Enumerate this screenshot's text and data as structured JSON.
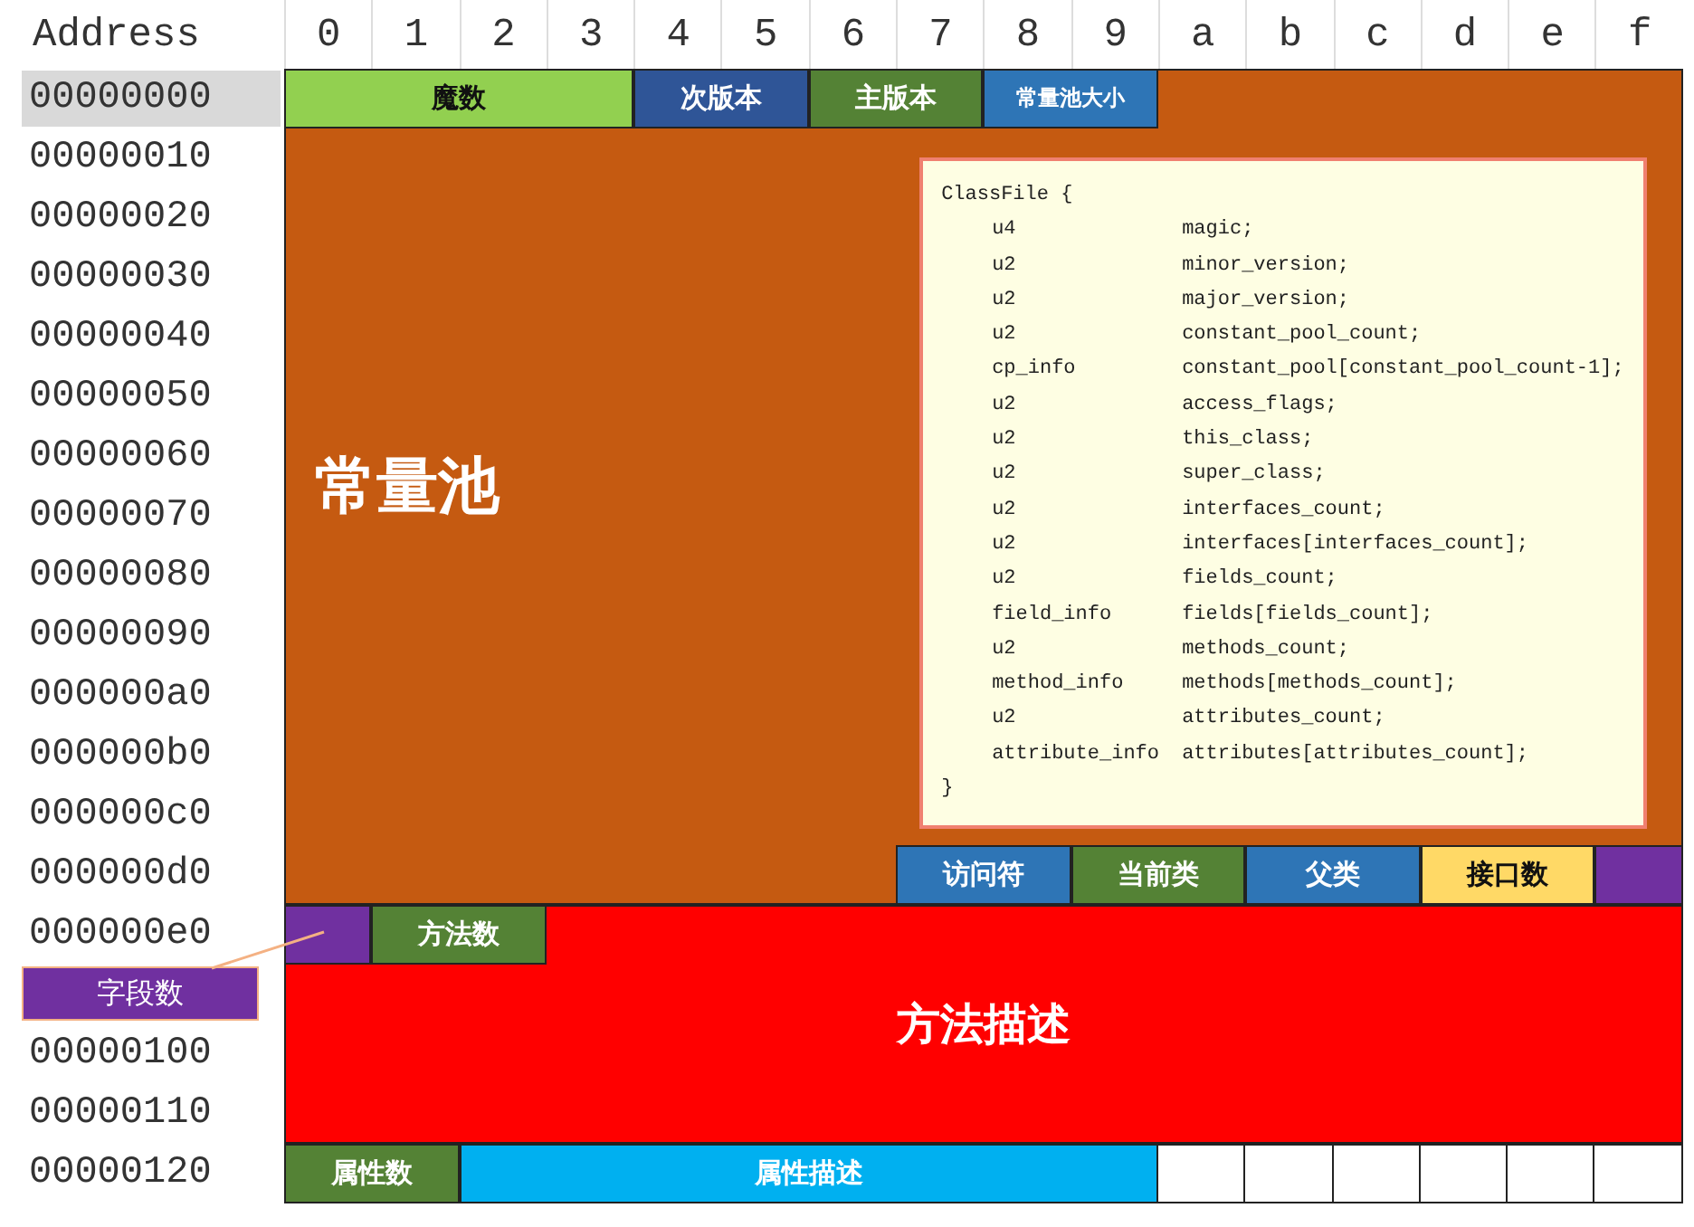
{
  "header": {
    "label": "Address",
    "columns": [
      "0",
      "1",
      "2",
      "3",
      "4",
      "5",
      "6",
      "7",
      "8",
      "9",
      "a",
      "b",
      "c",
      "d",
      "e",
      "f"
    ]
  },
  "rows": [
    {
      "kind": "address",
      "text": "00000000",
      "selected": true
    },
    {
      "kind": "address",
      "text": "00000010",
      "selected": false
    },
    {
      "kind": "address",
      "text": "00000020",
      "selected": false
    },
    {
      "kind": "address",
      "text": "00000030",
      "selected": false
    },
    {
      "kind": "address",
      "text": "00000040",
      "selected": false
    },
    {
      "kind": "address",
      "text": "00000050",
      "selected": false
    },
    {
      "kind": "address",
      "text": "00000060",
      "selected": false
    },
    {
      "kind": "address",
      "text": "00000070",
      "selected": false
    },
    {
      "kind": "address",
      "text": "00000080",
      "selected": false
    },
    {
      "kind": "address",
      "text": "00000090",
      "selected": false
    },
    {
      "kind": "address",
      "text": "000000a0",
      "selected": false
    },
    {
      "kind": "address",
      "text": "000000b0",
      "selected": false
    },
    {
      "kind": "address",
      "text": "000000c0",
      "selected": false
    },
    {
      "kind": "address",
      "text": "000000d0",
      "selected": false
    },
    {
      "kind": "address",
      "text": "000000e0",
      "selected": false
    },
    {
      "kind": "callout",
      "text": "字段数",
      "color": "#7030a0"
    },
    {
      "kind": "address",
      "text": "00000100",
      "selected": false
    },
    {
      "kind": "address",
      "text": "00000110",
      "selected": false
    },
    {
      "kind": "address",
      "text": "00000120",
      "selected": false
    }
  ],
  "blocks": [
    {
      "label": "魔数",
      "color": "#92d050"
    },
    {
      "label": "次版本",
      "color": "#2f5597"
    },
    {
      "label": "主版本",
      "color": "#548235"
    },
    {
      "label": "常量池大小",
      "color": "#2e75b6"
    },
    {
      "label": "常量池",
      "color": "#c55a11"
    },
    {
      "label": "访问符",
      "color": "#2e75b6"
    },
    {
      "label": "当前类",
      "color": "#548235"
    },
    {
      "label": "父类",
      "color": "#2e75b6"
    },
    {
      "label": "接口数",
      "color": "#ffd966"
    },
    {
      "color": "#7030a0"
    },
    {
      "color": "#7030a0"
    },
    {
      "label": "方法数",
      "color": "#548235"
    },
    {
      "label": "方法描述",
      "color": "#ff0000"
    },
    {
      "label": "属性数",
      "color": "#548235"
    },
    {
      "label": "属性描述",
      "color": "#00b0f0"
    }
  ],
  "code": {
    "header": "ClassFile {",
    "footer": "}",
    "lines": [
      {
        "type": "u4",
        "name": "magic;"
      },
      {
        "type": "u2",
        "name": "minor_version;"
      },
      {
        "type": "u2",
        "name": "major_version;"
      },
      {
        "type": "u2",
        "name": "constant_pool_count;"
      },
      {
        "type": "cp_info",
        "name": "constant_pool[constant_pool_count-1];"
      },
      {
        "type": "u2",
        "name": "access_flags;"
      },
      {
        "type": "u2",
        "name": "this_class;"
      },
      {
        "type": "u2",
        "name": "super_class;"
      },
      {
        "type": "u2",
        "name": "interfaces_count;"
      },
      {
        "type": "u2",
        "name": "interfaces[interfaces_count];"
      },
      {
        "type": "u2",
        "name": "fields_count;"
      },
      {
        "type": "field_info",
        "name": "fields[fields_count];"
      },
      {
        "type": "u2",
        "name": "methods_count;"
      },
      {
        "type": "method_info",
        "name": "methods[methods_count];"
      },
      {
        "type": "u2",
        "name": "attributes_count;"
      },
      {
        "type": "attribute_info",
        "name": "attributes[attributes_count];"
      }
    ]
  }
}
